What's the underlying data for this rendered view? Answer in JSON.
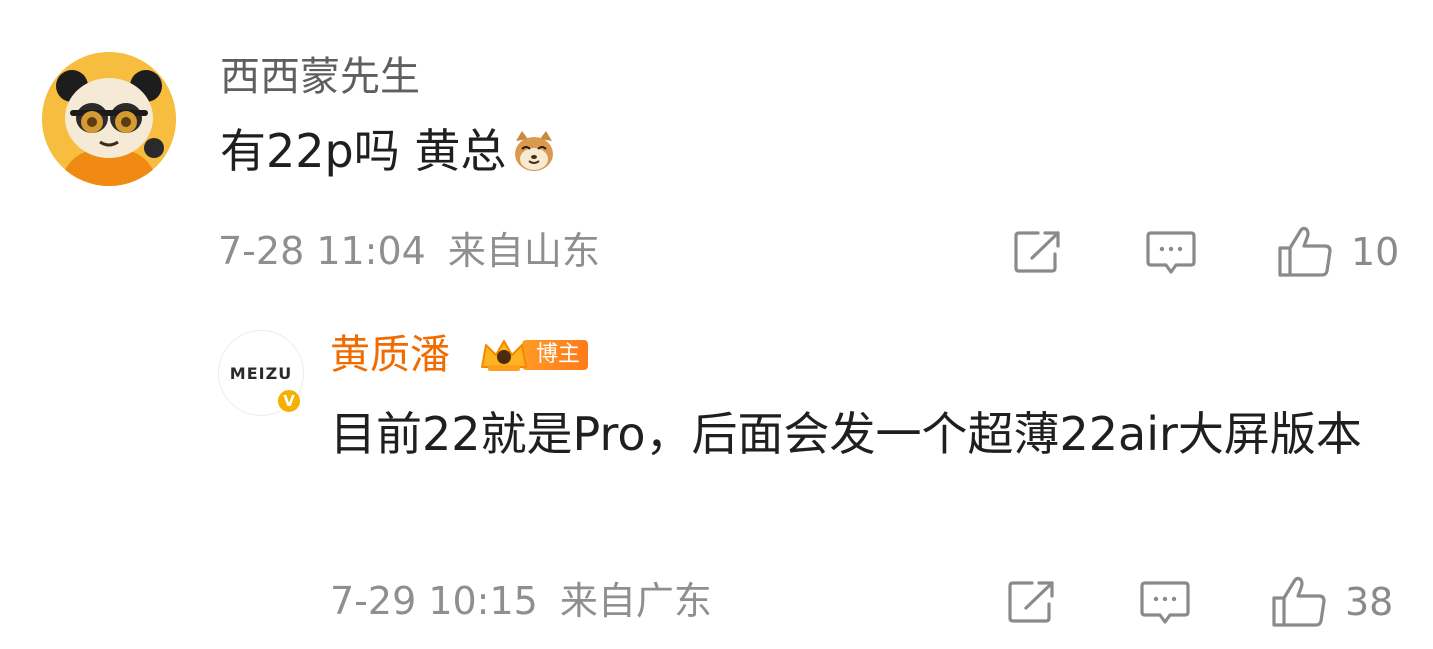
{
  "main_comment": {
    "username": "西西蒙先生",
    "text": "有22p吗 黄总",
    "emoji": "cat-emoji",
    "time": "7-28 11:04",
    "location": "来自山东",
    "like_count": "10"
  },
  "reply": {
    "avatar_brand": "MEIZU",
    "verified_mark": "V",
    "username": "黄质潘",
    "badge_label": "博主",
    "text": "目前22就是Pro，后面会发一个超薄22air大屏版本",
    "time": "7-29 10:15",
    "location": "来自广东",
    "like_count": "38"
  },
  "icons": {
    "share": "share-icon",
    "comment": "comment-icon",
    "like": "thumbs-up-icon"
  },
  "colors": {
    "username_highlight": "#f06b00",
    "meta_gray": "#8f8f8f",
    "badge_orange": "#ff8a1f",
    "verified_yellow": "#f5b000"
  }
}
